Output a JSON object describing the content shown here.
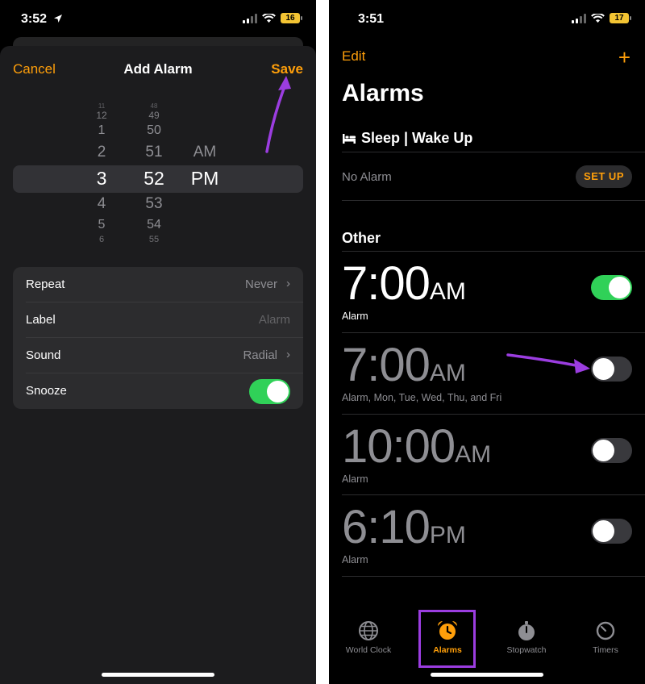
{
  "left": {
    "status": {
      "time": "3:52",
      "battery": "16"
    },
    "nav": {
      "cancel": "Cancel",
      "title": "Add Alarm",
      "save": "Save"
    },
    "picker": {
      "hours": [
        "11",
        "12",
        "1",
        "2",
        "3",
        "4",
        "5",
        "6"
      ],
      "minutes": [
        "48",
        "49",
        "50",
        "51",
        "52",
        "53",
        "54",
        "55"
      ],
      "ampm": [
        "AM",
        "PM"
      ],
      "selected": {
        "hour": "3",
        "minute": "52",
        "ampm": "PM"
      }
    },
    "settings": {
      "repeat": {
        "label": "Repeat",
        "value": "Never"
      },
      "label": {
        "label": "Label",
        "placeholder": "Alarm"
      },
      "sound": {
        "label": "Sound",
        "value": "Radial"
      },
      "snooze": {
        "label": "Snooze",
        "on": true
      }
    },
    "colors": {
      "accent": "#ff9f0a",
      "toggle_on": "#30d158",
      "annotation": "#9b3de0"
    }
  },
  "right": {
    "status": {
      "time": "3:51",
      "battery": "17"
    },
    "nav": {
      "edit": "Edit",
      "add": "+"
    },
    "title": "Alarms",
    "sleep": {
      "heading": "Sleep | Wake Up",
      "icon": "bed-icon",
      "no_alarm": "No Alarm",
      "setup": "SET UP"
    },
    "other_heading": "Other",
    "alarms": [
      {
        "time": "7:00",
        "ampm": "AM",
        "label": "Alarm",
        "on": true
      },
      {
        "time": "7:00",
        "ampm": "AM",
        "label": "Alarm, Mon, Tue, Wed, Thu, and Fri",
        "on": false
      },
      {
        "time": "10:00",
        "ampm": "AM",
        "label": "Alarm",
        "on": false
      },
      {
        "time": "6:10",
        "ampm": "PM",
        "label": "Alarm",
        "on": false
      }
    ],
    "tabs": [
      {
        "label": "World Clock",
        "icon": "globe-icon",
        "active": false
      },
      {
        "label": "Alarms",
        "icon": "alarm-clock-icon",
        "active": true
      },
      {
        "label": "Stopwatch",
        "icon": "stopwatch-icon",
        "active": false
      },
      {
        "label": "Timers",
        "icon": "timer-icon",
        "active": false
      }
    ]
  }
}
